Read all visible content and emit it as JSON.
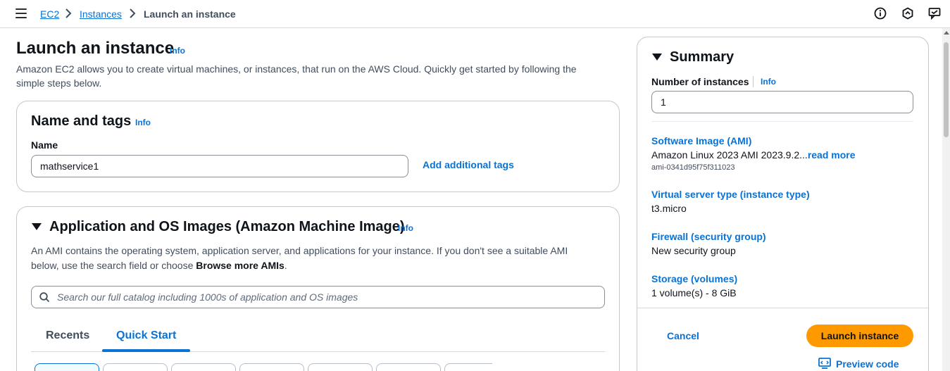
{
  "breadcrumb": {
    "items": [
      "EC2",
      "Instances"
    ],
    "current": "Launch an instance"
  },
  "header_icons": [
    "info-circle-icon",
    "notifications-icon",
    "feedback-icon"
  ],
  "page": {
    "title": "Launch an instance",
    "info": "Info",
    "description": "Amazon EC2 allows you to create virtual machines, or instances, that run on the AWS Cloud. Quickly get started by following the simple steps below."
  },
  "name_tags": {
    "title": "Name and tags",
    "info": "Info",
    "name_label": "Name",
    "name_value": "mathservice1",
    "add_tags": "Add additional tags"
  },
  "ami": {
    "title": "Application and OS Images (Amazon Machine Image)",
    "info": "Info",
    "description_prefix": "An AMI contains the operating system, application server, and applications for your instance. If you don't see a suitable AMI below, use the search field or choose ",
    "description_bold": "Browse more AMIs",
    "description_suffix": ".",
    "search_placeholder": "Search our full catalog including 1000s of application and OS images",
    "tabs": [
      "Recents",
      "Quick Start"
    ],
    "active_tab": "Quick Start"
  },
  "summary": {
    "title": "Summary",
    "instances_label": "Number of instances",
    "info": "Info",
    "instances_value": "1",
    "software_image_label": "Software Image (AMI)",
    "software_image_value": "Amazon Linux 2023 AMI 2023.9.2...",
    "read_more": "read more",
    "ami_id": "ami-0341d95f75f311023",
    "instance_type_label": "Virtual server type (instance type)",
    "instance_type_value": "t3.micro",
    "firewall_label": "Firewall (security group)",
    "firewall_value": "New security group",
    "storage_label": "Storage (volumes)",
    "storage_value": "1 volume(s) - 8 GiB",
    "cancel": "Cancel",
    "launch": "Launch instance",
    "preview_code": "Preview code"
  },
  "colors": {
    "link": "#0972d3",
    "primary_button": "#ff9900",
    "text": "#0f141a",
    "border": "#c6c6cd"
  }
}
